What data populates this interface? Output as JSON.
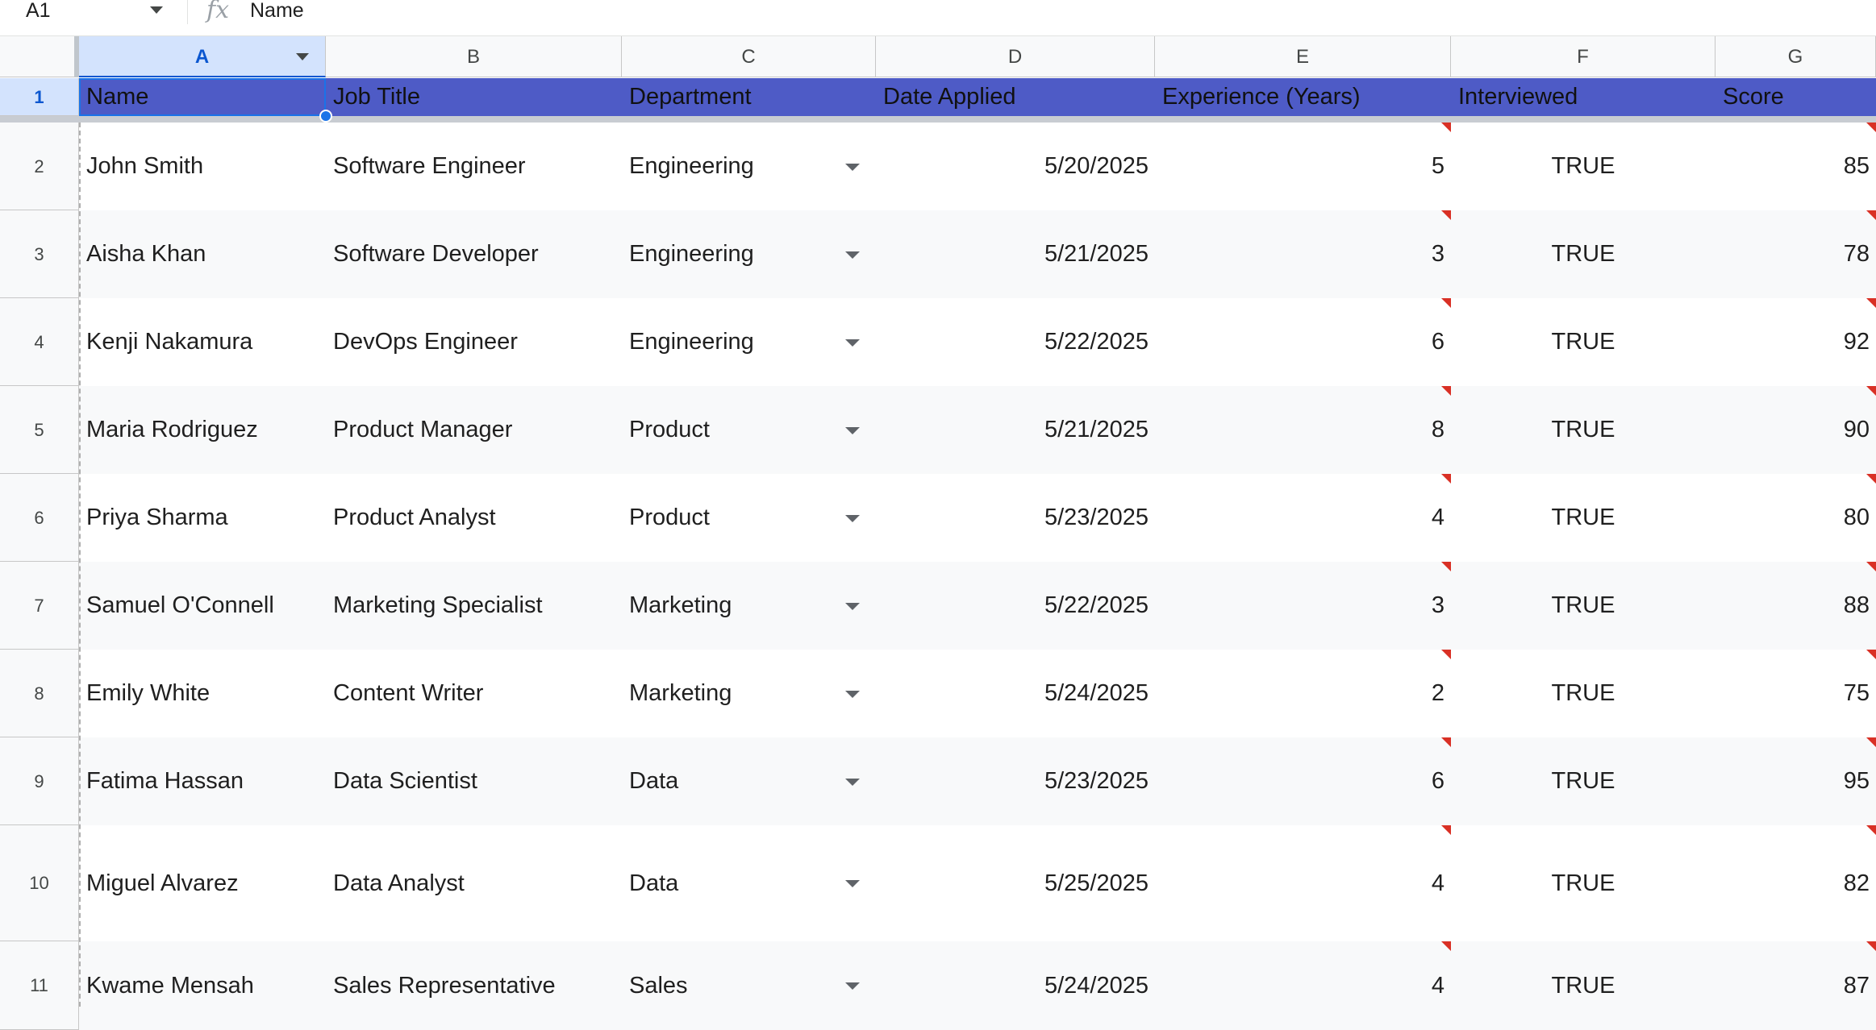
{
  "formula_bar": {
    "name_box": "A1",
    "fx_icon": "fx-icon",
    "content": "Name"
  },
  "columns": [
    "A",
    "B",
    "C",
    "D",
    "E",
    "F",
    "G"
  ],
  "header": {
    "row_number": "1",
    "cells": [
      "Name",
      "Job Title",
      "Department",
      "Date Applied",
      "Experience (Years)",
      "Interviewed",
      "Score"
    ]
  },
  "rows": [
    {
      "num": "2",
      "name": "John Smith",
      "title": "Software Engineer",
      "dept": "Engineering",
      "date": "5/20/2025",
      "exp": "5",
      "interviewed": "TRUE",
      "score": "85"
    },
    {
      "num": "3",
      "name": "Aisha Khan",
      "title": "Software Developer",
      "dept": "Engineering",
      "date": "5/21/2025",
      "exp": "3",
      "interviewed": "TRUE",
      "score": "78"
    },
    {
      "num": "4",
      "name": "Kenji Nakamura",
      "title": "DevOps Engineer",
      "dept": "Engineering",
      "date": "5/22/2025",
      "exp": "6",
      "interviewed": "TRUE",
      "score": "92"
    },
    {
      "num": "5",
      "name": "Maria Rodriguez",
      "title": "Product Manager",
      "dept": "Product",
      "date": "5/21/2025",
      "exp": "8",
      "interviewed": "TRUE",
      "score": "90"
    },
    {
      "num": "6",
      "name": "Priya Sharma",
      "title": "Product Analyst",
      "dept": "Product",
      "date": "5/23/2025",
      "exp": "4",
      "interviewed": "TRUE",
      "score": "80"
    },
    {
      "num": "7",
      "name": "Samuel O'Connell",
      "title": "Marketing Specialist",
      "dept": "Marketing",
      "date": "5/22/2025",
      "exp": "3",
      "interviewed": "TRUE",
      "score": "88"
    },
    {
      "num": "8",
      "name": "Emily White",
      "title": "Content Writer",
      "dept": "Marketing",
      "date": "5/24/2025",
      "exp": "2",
      "interviewed": "TRUE",
      "score": "75"
    },
    {
      "num": "9",
      "name": "Fatima Hassan",
      "title": "Data Scientist",
      "dept": "Data",
      "date": "5/23/2025",
      "exp": "6",
      "interviewed": "TRUE",
      "score": "95"
    },
    {
      "num": "10",
      "name": "Miguel Alvarez",
      "title": "Data Analyst",
      "dept": "Data",
      "date": "5/25/2025",
      "exp": "4",
      "interviewed": "TRUE",
      "score": "82"
    },
    {
      "num": "11",
      "name": "Kwame Mensah",
      "title": "Sales Representative",
      "dept": "Sales",
      "date": "5/24/2025",
      "exp": "4",
      "interviewed": "TRUE",
      "score": "87"
    }
  ],
  "colors": {
    "header_fill": "#4e5bc6",
    "selection": "#1a73e8",
    "band_alt": "#f8f9fa",
    "note_marker": "#d93025"
  }
}
